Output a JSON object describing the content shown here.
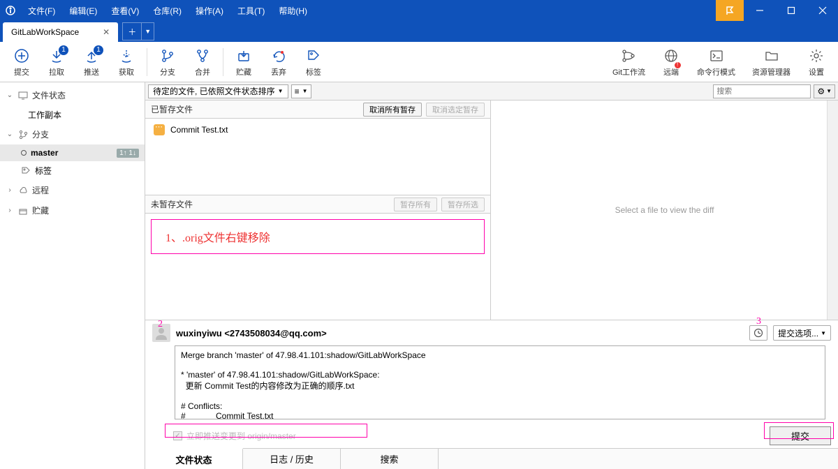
{
  "menu": [
    "文件(F)",
    "编辑(E)",
    "查看(V)",
    "仓库(R)",
    "操作(A)",
    "工具(T)",
    "帮助(H)"
  ],
  "tab": {
    "title": "GitLabWorkSpace"
  },
  "toolbar": {
    "commit": "提交",
    "pull": "拉取",
    "push": "推送",
    "fetch": "获取",
    "branch": "分支",
    "merge": "合并",
    "stash": "贮藏",
    "discard": "丢弃",
    "tag": "标签",
    "gitflow": "Git工作流",
    "remote": "远端",
    "terminal": "命令行模式",
    "explorer": "资源管理器",
    "settings": "设置",
    "pull_badge": "1",
    "push_badge": "1"
  },
  "sidebar": {
    "file_status": "文件状态",
    "working_copy": "工作副本",
    "branches": "分支",
    "master": "master",
    "master_counts": "1↑ 1↓",
    "tags": "标签",
    "remotes": "远程",
    "stashes": "贮藏"
  },
  "filter": {
    "staged_sort": "待定的文件, 已依照文件状态排序",
    "search_placeholder": "搜索"
  },
  "staged": {
    "title": "已暂存文件",
    "unstage_all": "取消所有暂存",
    "unstage_sel": "取消选定暂存",
    "files": [
      "Commit Test.txt"
    ]
  },
  "unstaged": {
    "title": "未暂存文件",
    "stage_all": "暂存所有",
    "stage_sel": "暂存所选",
    "annotation": "1、.orig文件右键移除"
  },
  "diff": {
    "placeholder": "Select a file to view the diff"
  },
  "commit": {
    "author": "wuxinyiwu <2743508034@qq.com>",
    "options": "提交选项...",
    "message": "Merge branch 'master' of 47.98.41.101:shadow/GitLabWorkSpace\n\n* 'master' of 47.98.41.101:shadow/GitLabWorkSpace:\n  更新 Commit Test的内容修改为正确的顺序.txt\n\n# Conflicts:\n#             Commit Test.txt",
    "push_immediately": "立即推送变更到 origin/master",
    "commit_btn": "提交",
    "annot2": "2",
    "annot3": "3"
  },
  "bottom_tabs": {
    "file_status": "文件状态",
    "log": "日志 / 历史",
    "search": "搜索"
  }
}
